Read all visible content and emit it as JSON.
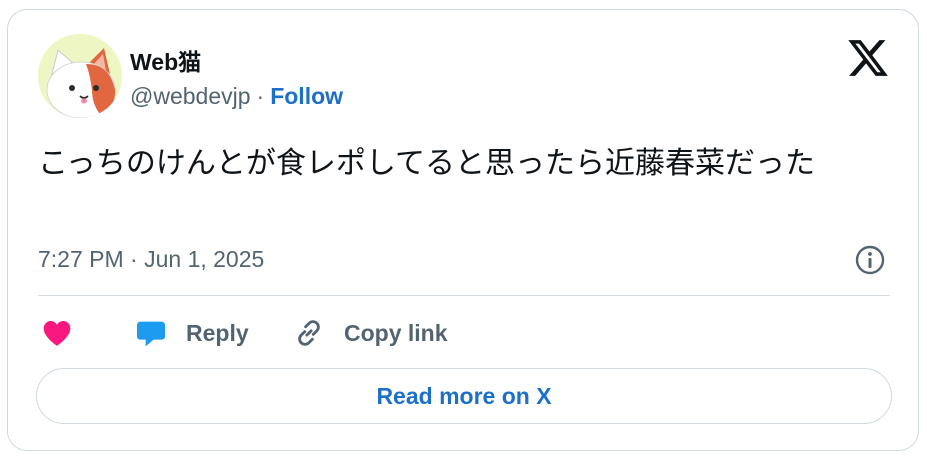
{
  "tweet": {
    "author_name": "Web猫",
    "author_handle": "@webdevjp",
    "separator": "·",
    "follow_label": "Follow",
    "text": "こっちのけんとが食レポしてると思ったら近藤春菜だった",
    "timestamp": "7:27 PM · Jun 1, 2025"
  },
  "actions": {
    "like_icon": "heart-icon",
    "reply_label": "Reply",
    "reply_icon": "speech-bubble-icon",
    "copy_link_label": "Copy link",
    "copy_link_icon": "link-icon"
  },
  "footer": {
    "read_more_label": "Read more on X"
  },
  "colors": {
    "accent": "#1d70c9",
    "like": "#f91880",
    "reply": "#1d9bf0",
    "text": "#0f1419",
    "muted": "#536471",
    "border": "#cfd9de"
  }
}
